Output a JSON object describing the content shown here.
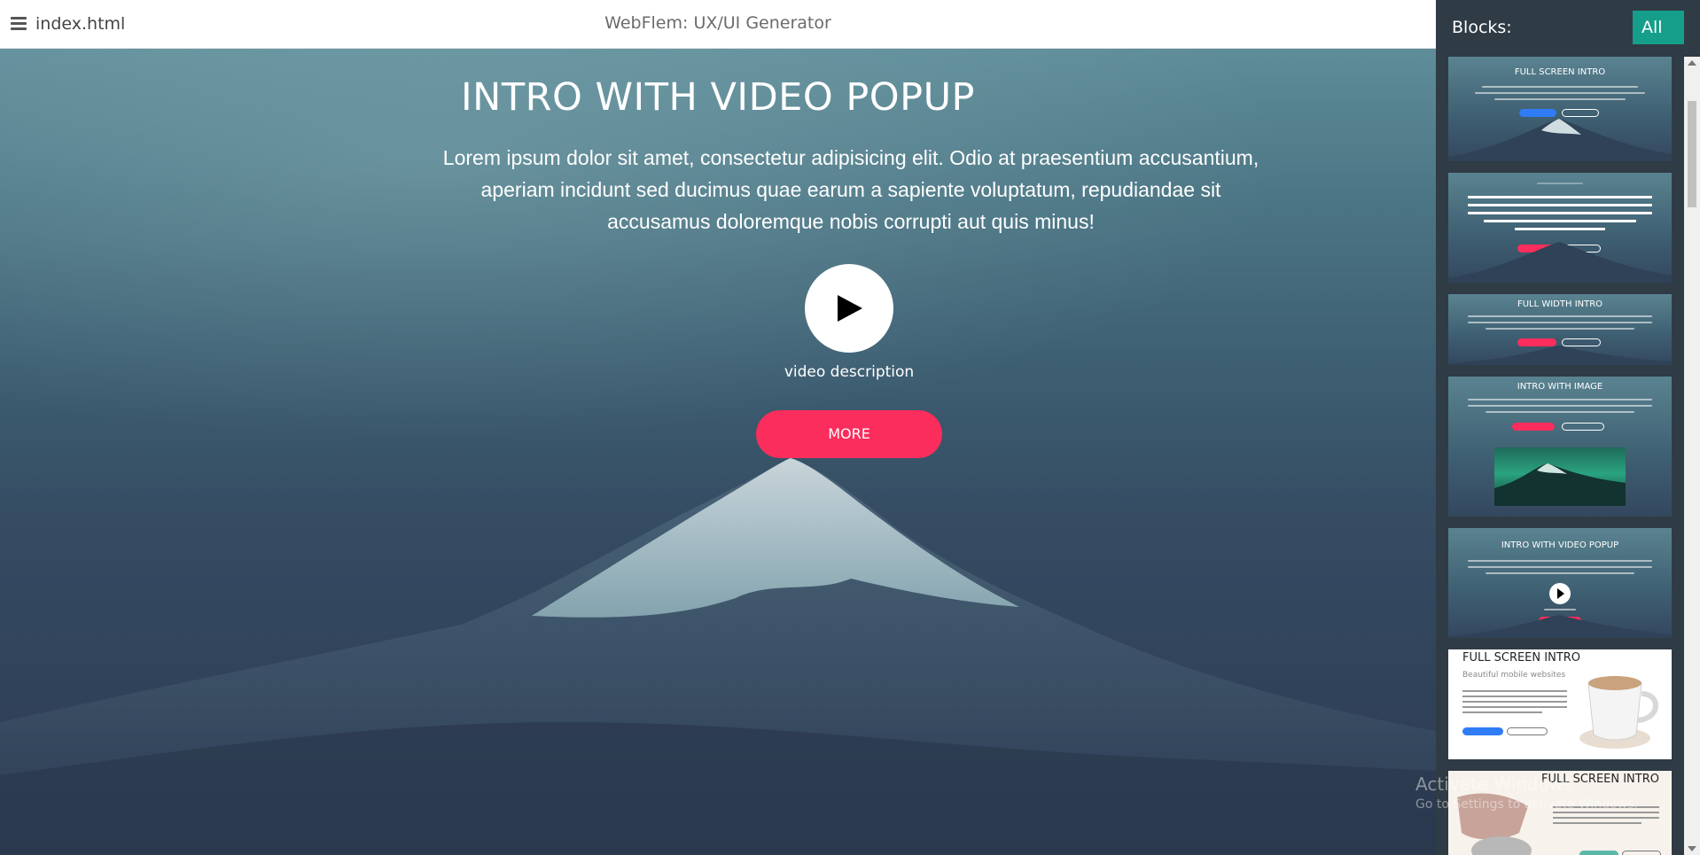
{
  "topbar": {
    "menu_icon": "hamburger-menu-icon",
    "filename": "index.html",
    "app_title": "WebFlem: UX/UI Generator"
  },
  "hero": {
    "title": "INTRO WITH VIDEO POPUP",
    "text": "Lorem ipsum dolor sit amet, consectetur adipisicing elit. Odio at praesentium accusantium, aperiam incidunt sed ducimus quae earum a sapiente voluptatum, repudiandae sit accusamus doloremque nobis corrupti aut quis minus!",
    "play_icon": "play-icon",
    "video_description": "video description",
    "more_label": "MORE",
    "accent_color": "#fb2d5c"
  },
  "sidebar": {
    "title": "Blocks:",
    "filter_label": "All",
    "filter_color": "#159e8a",
    "thumbnails": [
      {
        "title": "FULL SCREEN INTRO",
        "variant": "dark"
      },
      {
        "title": "FULL SCREEN INTRO",
        "variant": "dark"
      },
      {
        "title": "FULL WIDTH INTRO",
        "variant": "dark"
      },
      {
        "title": "INTRO WITH IMAGE",
        "variant": "dark"
      },
      {
        "title": "INTRO WITH VIDEO POPUP",
        "variant": "dark"
      },
      {
        "title": "FULL SCREEN INTRO",
        "subtitle": "Beautiful mobile websites",
        "variant": "light"
      },
      {
        "title": "FULL SCREEN INTRO",
        "variant": "light"
      }
    ]
  },
  "watermark": {
    "line1": "Activate Windows",
    "line2": "Go to Settings to activate Windows."
  }
}
